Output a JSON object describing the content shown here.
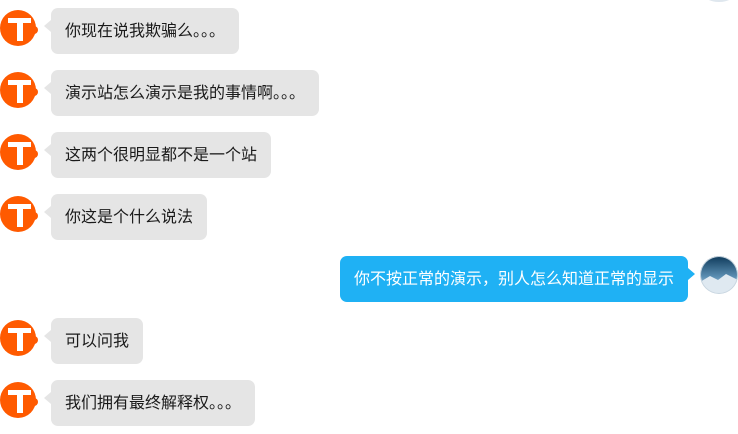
{
  "colors": {
    "incoming_bubble": "#e5e5e5",
    "outgoing_bubble": "#1fb1f4",
    "brand_avatar": "#ff5a00"
  },
  "messages": [
    {
      "side": "left",
      "text": "你现在说我欺骗么。。。",
      "avatar": "brand-logo-icon"
    },
    {
      "side": "left",
      "text": "演示站怎么演示是我的事情啊。。。",
      "avatar": "brand-logo-icon"
    },
    {
      "side": "left",
      "text": "这两个很明显都不是一个站",
      "avatar": "brand-logo-icon"
    },
    {
      "side": "left",
      "text": "你这是个什么说法",
      "avatar": "brand-logo-icon"
    },
    {
      "side": "right",
      "text": "你不按正常的演示，别人怎么知道正常的显示",
      "avatar": "user-avatar"
    },
    {
      "side": "left",
      "text": "可以问我",
      "avatar": "brand-logo-icon"
    },
    {
      "side": "left",
      "text": "我们拥有最终解释权。。。",
      "avatar": "brand-logo-icon"
    }
  ]
}
